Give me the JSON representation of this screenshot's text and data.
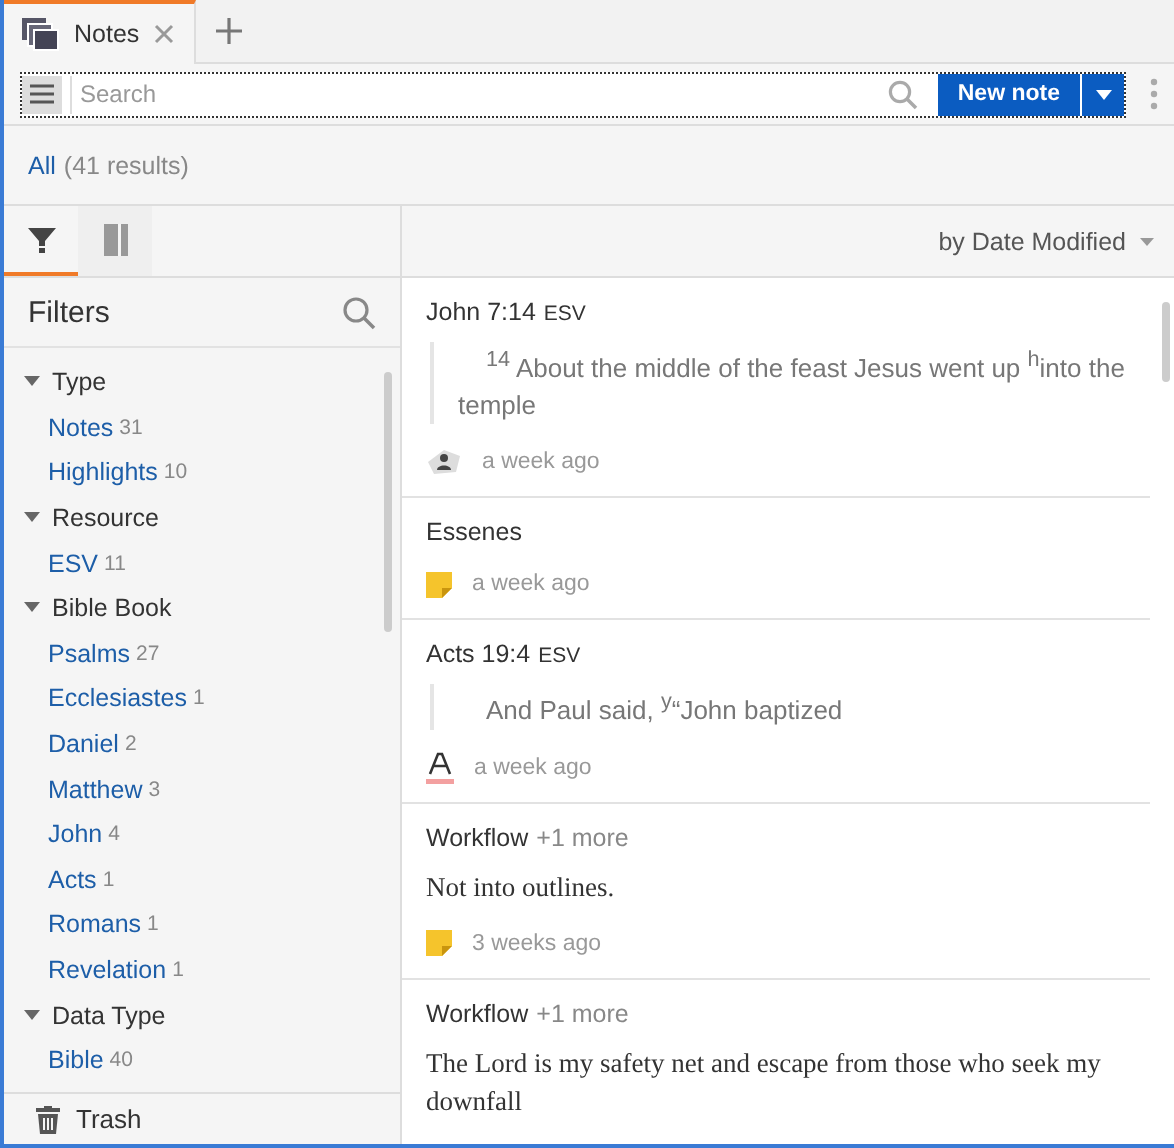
{
  "tabs": [
    {
      "label": "Notes",
      "selected": true
    }
  ],
  "toolbar": {
    "search_placeholder": "Search",
    "new_note_button": "New note"
  },
  "scope": {
    "label": "All",
    "count": "(41 results)"
  },
  "sidebar_tabs": [
    {
      "kind": "filter",
      "selected": true
    },
    {
      "kind": "book",
      "selected": false
    }
  ],
  "filters": {
    "title": "Filters",
    "groups": [
      {
        "label": "Type",
        "expanded": true,
        "children": [
          {
            "label": "Notes",
            "count": "31"
          },
          {
            "label": "Highlights",
            "count": "10"
          }
        ]
      },
      {
        "label": "Resource",
        "expanded": true,
        "children": [
          {
            "label": "ESV",
            "count": "11"
          }
        ]
      },
      {
        "label": "Bible Book",
        "expanded": true,
        "children": [
          {
            "label": "Psalms",
            "count": "27"
          },
          {
            "label": "Ecclesiastes",
            "count": "1"
          },
          {
            "label": "Daniel",
            "count": "2"
          },
          {
            "label": "Matthew",
            "count": "3"
          },
          {
            "label": "John",
            "count": "4"
          },
          {
            "label": "Acts",
            "count": "1"
          },
          {
            "label": "Romans",
            "count": "1"
          },
          {
            "label": "Revelation",
            "count": "1"
          }
        ]
      },
      {
        "label": "Data Type",
        "expanded": true,
        "children": [
          {
            "label": "Bible",
            "count": "40"
          }
        ]
      }
    ]
  },
  "trash": "Trash",
  "sort": "by Date Modified",
  "notes": [
    {
      "kind": "verse",
      "title": "John 7:14",
      "version": "ESV",
      "quote": "$^{14}$ About the middle of the feast Jesus went up $^{h}$into the temple",
      "time": "a week ago"
    },
    {
      "kind": "note",
      "title": "Essenes",
      "time": "a week ago"
    },
    {
      "kind": "highlight",
      "title": "Acts 19:4",
      "version": "ESV",
      "quote": "And Paul said, $^{y}$“John baptized",
      "time": "a week ago"
    },
    {
      "kind": "note",
      "title": "Workflow",
      "more": "+1 more",
      "body": "Not into outlines.",
      "time": "3 weeks ago"
    },
    {
      "kind": "note",
      "title": "Workflow",
      "more": "+1 more",
      "body": "The Lord is my safety net and escape from those who seek my downfall"
    }
  ]
}
